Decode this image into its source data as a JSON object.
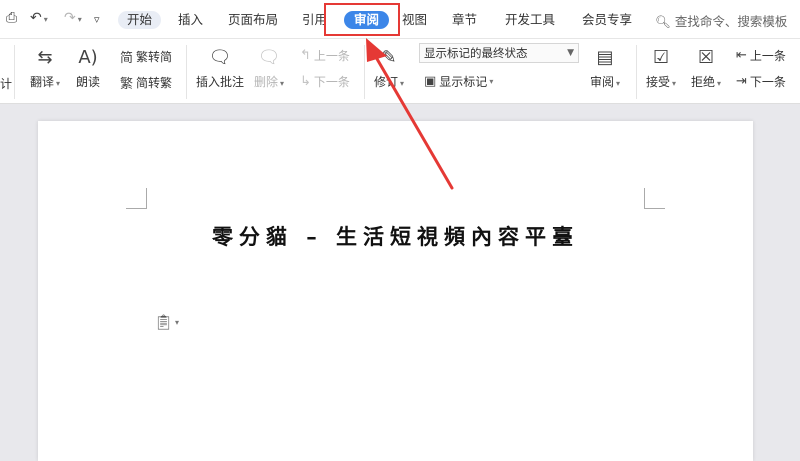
{
  "quick_access": {
    "doc_icon": "doc-preview-icon",
    "undo_icon": "undo-icon",
    "redo_icon": "redo-icon",
    "more_icon": "chevron-down-icon"
  },
  "menu": {
    "tabs": [
      "开始",
      "插入",
      "页面布局",
      "引用",
      "审阅",
      "视图",
      "章节",
      "开发工具",
      "会员专享"
    ],
    "search_placeholder": "查找命令、搜索模板"
  },
  "ribbon": {
    "left_cut": "计",
    "translate": "翻译",
    "read_aloud": "朗读",
    "trad_to_simp": "繁转简",
    "simp_to_trad": "简转繁",
    "insert_comment": "插入批注",
    "delete": "删除",
    "prev_comment": "上一条",
    "next_comment": "下一条",
    "track_changes": "修订",
    "markup_select": "显示标记的最终状态",
    "show_markup": "显示标记",
    "review": "审阅",
    "accept": "接受",
    "reject": "拒绝",
    "prev_change": "上一条",
    "next_change": "下一条"
  },
  "document": {
    "title": "零分貓 – 生活短視頻內容平臺"
  },
  "colors": {
    "accent": "#3c86e8",
    "highlight": "#e53935"
  }
}
